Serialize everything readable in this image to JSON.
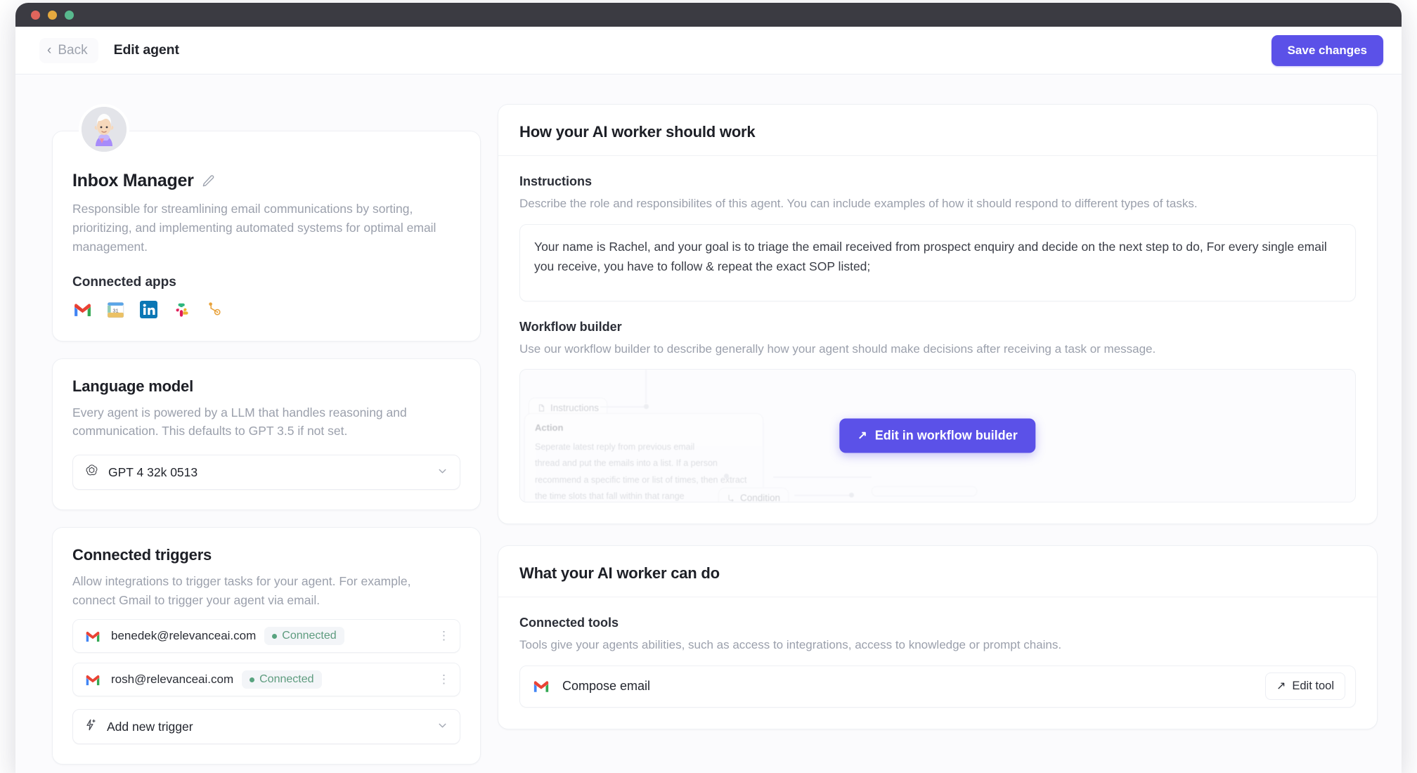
{
  "window": {
    "traffic_lights": [
      "close",
      "minimize",
      "maximize"
    ]
  },
  "header": {
    "back_label": "Back",
    "back_icon": "chevron-left-icon",
    "title": "Edit agent",
    "save_label": "Save changes",
    "accent_color": "#5b51e8"
  },
  "profile": {
    "avatar_icon": "agent-avatar",
    "name": "Inbox Manager",
    "edit_icon": "pencil-icon",
    "description": "Responsible for streamlining email communications by sorting, prioritizing, and implementing automated systems for optimal email management.",
    "connected_apps_label": "Connected apps",
    "apps": [
      {
        "name": "Gmail",
        "icon": "gmail-icon"
      },
      {
        "name": "Google Calendar",
        "icon": "google-calendar-icon"
      },
      {
        "name": "LinkedIn",
        "icon": "linkedin-icon"
      },
      {
        "name": "Slack",
        "icon": "slack-icon"
      },
      {
        "name": "HubSpot",
        "icon": "hubspot-icon"
      }
    ]
  },
  "language_model": {
    "title": "Language model",
    "description": "Every agent is powered by a LLM that handles reasoning and communication. This defaults to GPT 3.5 if not set.",
    "selected": "GPT 4 32k 0513",
    "model_icon": "openai-icon",
    "caret_icon": "chevron-down-icon"
  },
  "connected_triggers": {
    "title": "Connected triggers",
    "description": "Allow integrations to trigger tasks for your agent. For example, connect Gmail to trigger your agent via email.",
    "rows": [
      {
        "icon": "gmail-icon",
        "email": "benedek@relevanceai.com",
        "status": "Connected",
        "menu_icon": "kebab-menu-icon"
      },
      {
        "icon": "gmail-icon",
        "email": "rosh@relevanceai.com",
        "status": "Connected",
        "menu_icon": "kebab-menu-icon"
      }
    ],
    "add_label": "Add new trigger",
    "add_icon": "lightning-plus-icon",
    "add_caret_icon": "chevron-down-icon",
    "status_color": "#58a37f"
  },
  "work_panel": {
    "title": "How your AI worker should work",
    "instructions_label": "Instructions",
    "instructions_help": "Describe the role and responsibilites of this agent. You can include examples of how it should respond to different types of tasks.",
    "instructions_value": "Your name is Rachel, and your goal is to triage the email received from prospect enquiry and decide on the next step to do, For every single email you receive, you have to follow & repeat the exact SOP listed;",
    "workflow_label": "Workflow builder",
    "workflow_help": "Use our workflow builder to describe generally how your agent should make decisions after receiving a task or message.",
    "workflow_button": "Edit in workflow builder",
    "workflow_button_icon": "arrow-up-right-icon",
    "preview": {
      "node_instructions": "Instructions",
      "node_instructions_icon": "document-icon",
      "card_title": "Action",
      "card_lines": [
        "Seperate latest reply from previous email",
        "thread and put the emails into a list. If a person",
        "recommend a specific time or list of times, then extract",
        "the time slots that fall within that range"
      ],
      "node_condition": "Condition",
      "node_condition_icon": "branch-icon"
    }
  },
  "can_do_panel": {
    "title": "What your AI worker can do",
    "tools_label": "Connected tools",
    "tools_help": "Tools give your agents abilities, such as access to integrations, access to knowledge or prompt chains.",
    "tools": [
      {
        "icon": "gmail-icon",
        "name": "Compose email",
        "action_label": "Edit tool",
        "action_icon": "arrow-up-right-icon"
      }
    ]
  }
}
